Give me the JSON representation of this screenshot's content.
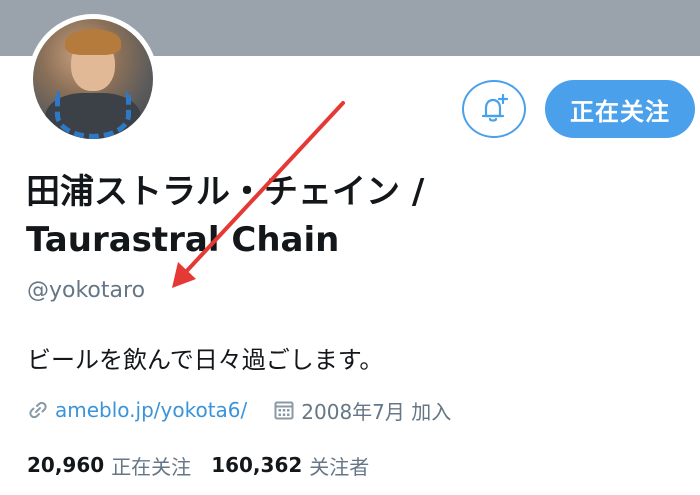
{
  "profile": {
    "display_name_line1": "田浦ストラル・チェイン /",
    "display_name_line2": "Taurastral Chain",
    "handle": "@yokotaro",
    "bio": "ビールを飲んで日々過ごします。",
    "website": "ameblo.jp/yokota6/",
    "joined": "2008年7月 加入"
  },
  "actions": {
    "follow_label": "正在关注",
    "notify_icon": "bell-plus-icon"
  },
  "stats": {
    "following_count": "20,960",
    "following_label": "正在关注",
    "followers_count": "160,362",
    "followers_label": "关注者"
  },
  "colors": {
    "accent": "#4aa0ea",
    "link": "#3b94d9",
    "muted": "#657786",
    "annotation_arrow": "#e53935",
    "banner": "#9aa3ab"
  }
}
